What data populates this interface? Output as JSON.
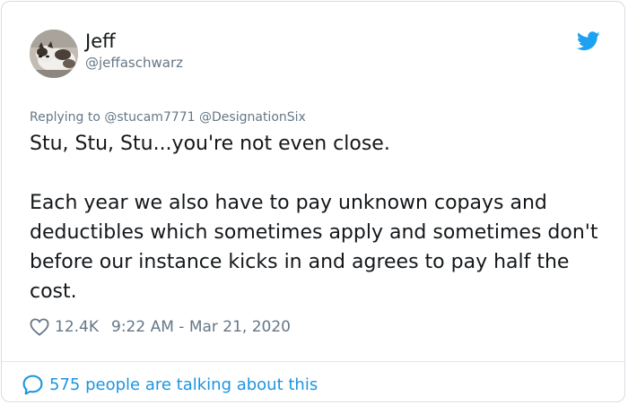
{
  "author": {
    "name": "Jeff",
    "handle": "@jeffaschwarz",
    "avatar_icon": "cat-photo-avatar"
  },
  "brand_icon": "twitter-bird-icon",
  "reply_context": "Replying to @stucam7771 @DesignationSix",
  "tweet": {
    "paragraphs": [
      "Stu, Stu, Stu...you're not even close.",
      "Each year we also have to pay unknown copays and deductibles which sometimes apply and sometimes don't before our instance kicks in and agrees to pay half the cost."
    ]
  },
  "meta": {
    "like_icon": "heart-icon",
    "likes": "12.4K",
    "timestamp": "9:22 AM - Mar 21, 2020"
  },
  "footer": {
    "talking_icon": "speech-bubble-icon",
    "talking_text": "575 people are talking about this"
  },
  "colors": {
    "text": "#14171a",
    "secondary": "#657786",
    "accent": "#1b95e0",
    "twitter_blue": "#1da1f2",
    "border": "#e1e8ed"
  }
}
